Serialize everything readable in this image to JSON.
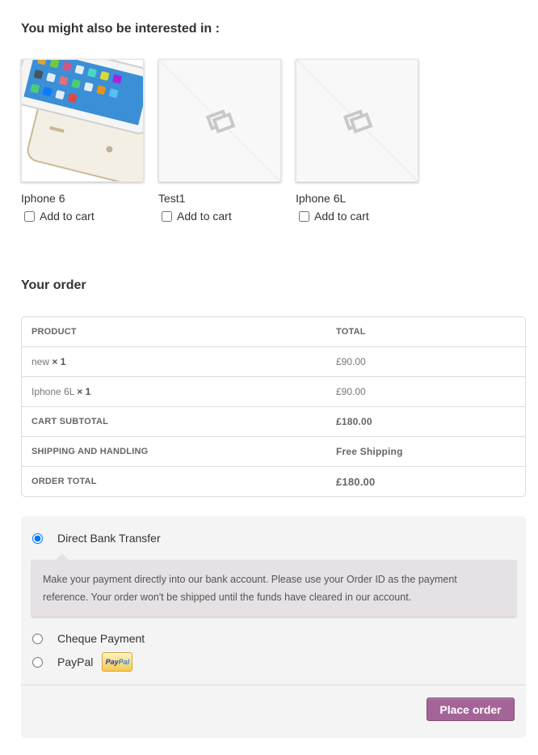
{
  "related": {
    "heading": "You might also be interested in :",
    "products": [
      {
        "name": "Iphone 6",
        "add_to_cart": "Add to cart",
        "image": "iphone-photo"
      },
      {
        "name": "Test1",
        "add_to_cart": "Add to cart",
        "image": "placeholder-icon"
      },
      {
        "name": "Iphone 6L",
        "add_to_cart": "Add to cart",
        "image": "placeholder-icon"
      }
    ]
  },
  "order": {
    "heading": "Your order",
    "columns": [
      "PRODUCT",
      "TOTAL"
    ],
    "items": [
      {
        "name": "new",
        "qty": "× 1",
        "total": "£90.00"
      },
      {
        "name": "Iphone 6L",
        "qty": "× 1",
        "total": "£90.00"
      }
    ],
    "subtotal": {
      "label": "CART SUBTOTAL",
      "value": "£180.00"
    },
    "shipping": {
      "label": "SHIPPING AND HANDLING",
      "value": "Free Shipping"
    },
    "total": {
      "label": "ORDER TOTAL",
      "value": "£180.00"
    }
  },
  "payment": {
    "methods": [
      {
        "label": "Direct Bank Transfer",
        "selected": true
      },
      {
        "label": "Cheque Payment",
        "selected": false
      },
      {
        "label": "PayPal",
        "selected": false
      }
    ],
    "bank_description": "Make your payment directly into our bank account. Please use your Order ID as the payment reference. Your order won't be shipped until the funds have cleared in our account.",
    "paypal_logo": {
      "part1": "Pay",
      "part2": "Pal"
    },
    "place_order": "Place order",
    "accent_color": "#a46497"
  }
}
